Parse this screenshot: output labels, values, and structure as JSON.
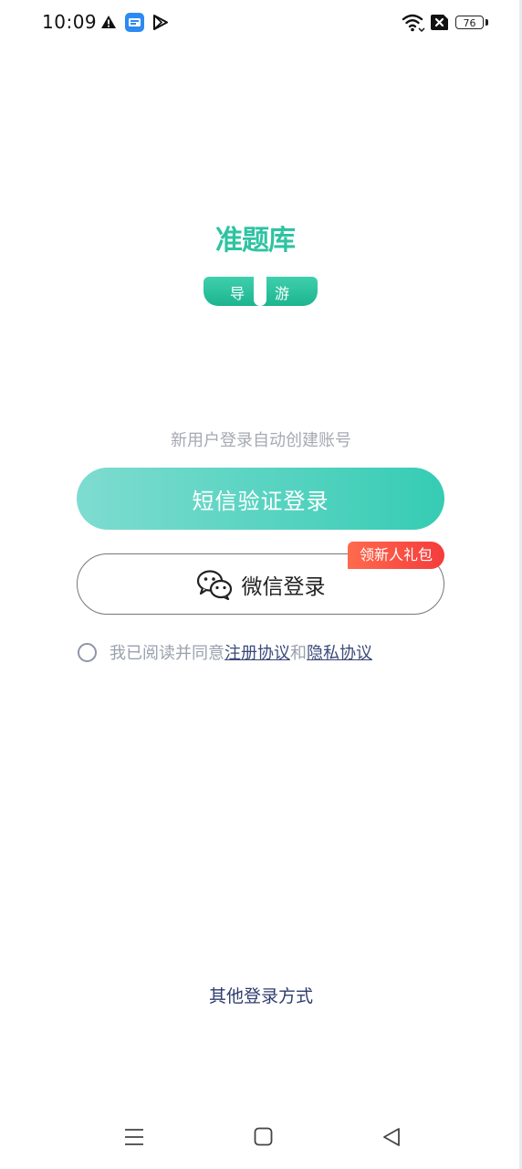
{
  "status_bar": {
    "time": "10:09",
    "battery": "76",
    "icons": [
      "warning-icon",
      "app-notification-icon",
      "play-store-icon",
      "wifi-icon",
      "sim-off-icon",
      "battery-icon"
    ]
  },
  "brand": {
    "logo_text": "准题库",
    "badge_left": "导",
    "badge_right": "游",
    "primary_color": "#2fc3a2",
    "accent_color": "#f7a51f"
  },
  "login": {
    "hint": "新用户登录自动创建账号",
    "sms_button": "短信验证登录",
    "wechat_button": "微信登录",
    "promo_badge": "领新人礼包",
    "agree_prefix": "我已阅读并同意",
    "terms_link": "注册协议",
    "agree_and": "和",
    "privacy_link": "隐私协议",
    "other_methods": "其他登录方式"
  },
  "nav_bar": {
    "icons": [
      "menu-icon",
      "home-icon",
      "back-icon"
    ]
  }
}
